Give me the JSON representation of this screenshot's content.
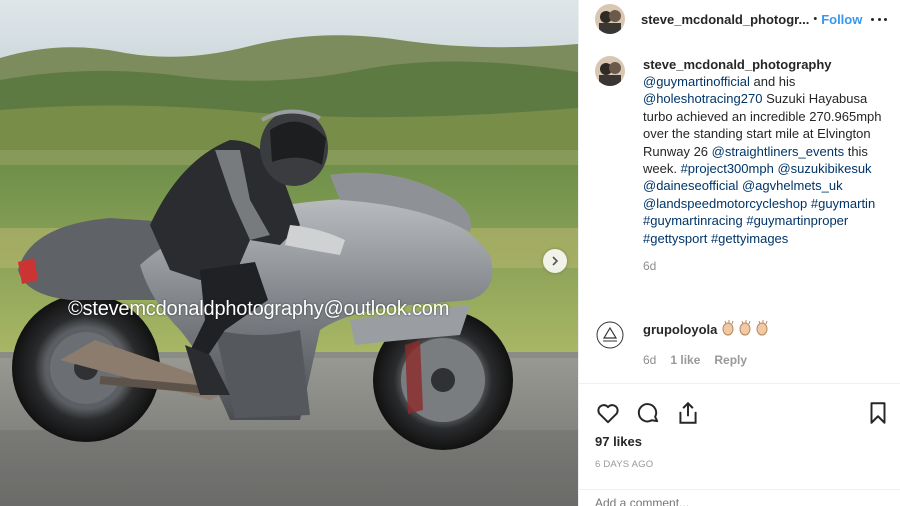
{
  "post": {
    "watermark": "©stevemcdonaldphotography@outlook.com",
    "header": {
      "username": "steve_mcdonald_photogr...",
      "separator": "•",
      "follow_label": "Follow"
    },
    "caption": {
      "username": "steve_mcdonald_photography",
      "parts": [
        {
          "text": "@guymartinofficial",
          "link": true
        },
        {
          "text": " and his ",
          "link": false
        },
        {
          "text": "@holeshotracing270",
          "link": true
        },
        {
          "text": " Suzuki Hayabusa turbo achieved an incredible 270.965mph over the standing start mile at Elvington Runway 26 ",
          "link": false
        },
        {
          "text": "@straightliners_events",
          "link": true
        },
        {
          "text": " this week. ",
          "link": false
        },
        {
          "text": "#project300mph",
          "link": true
        },
        {
          "text": " ",
          "link": false
        },
        {
          "text": "@suzukibikesuk",
          "link": true
        },
        {
          "text": " ",
          "link": false
        },
        {
          "text": "@daineseofficial",
          "link": true
        },
        {
          "text": " ",
          "link": false
        },
        {
          "text": "@agvhelmets_uk",
          "link": true
        },
        {
          "text": " ",
          "link": false
        },
        {
          "text": "@landspeedmotorcycleshop",
          "link": true
        },
        {
          "text": " ",
          "link": false
        },
        {
          "text": "#guymartin",
          "link": true
        },
        {
          "text": " ",
          "link": false
        },
        {
          "text": "#guymartinracing",
          "link": true
        },
        {
          "text": " ",
          "link": false
        },
        {
          "text": "#guymartinproper",
          "link": true
        },
        {
          "text": " ",
          "link": false
        },
        {
          "text": "#gettysport",
          "link": true
        },
        {
          "text": " ",
          "link": false
        },
        {
          "text": "#gettyimages",
          "link": true
        }
      ],
      "time": "6d"
    },
    "comment": {
      "username": "grupoloyola",
      "emoji": "clapping-hands x3",
      "time": "6d",
      "likes": "1 like",
      "reply_label": "Reply"
    },
    "likes_count": "97 likes",
    "date": "6 DAYS AGO",
    "comment_placeholder": "Add a comment...",
    "icons": [
      "heart-icon",
      "comment-icon",
      "share-icon",
      "bookmark-icon",
      "more-options-icon",
      "chevron-right-icon"
    ],
    "colors": {
      "link": "#003569",
      "follow": "#3897f0",
      "muted": "#8e8e8e"
    }
  }
}
